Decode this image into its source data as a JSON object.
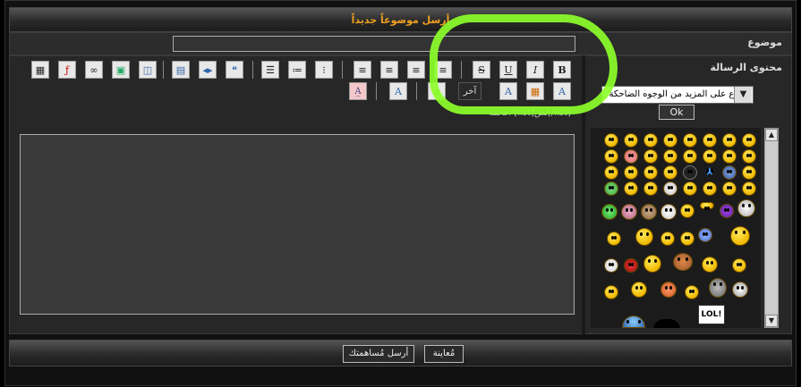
{
  "title": "أرسل موضوعاً جديداً",
  "subject": {
    "label": "موضوع",
    "value": ""
  },
  "message": {
    "label": "محتوى الرسالة"
  },
  "toolbar": {
    "bold": "B",
    "italic": "I",
    "underline": "U",
    "strike": "S",
    "other_label": "آخر"
  },
  "hint_text": "قائمة: [list]نص[/list]",
  "smilies": {
    "select_value": "اطلاع على المزيد من الوجوه الضاحكة",
    "ok_label": "Ok",
    "lol_label": "LOL!"
  },
  "buttons": {
    "submit": "أرسل مُساهمتك",
    "preview": "مُعاينة"
  },
  "colors": {
    "title": "#f0a020",
    "highlight": "#8cff2a"
  }
}
